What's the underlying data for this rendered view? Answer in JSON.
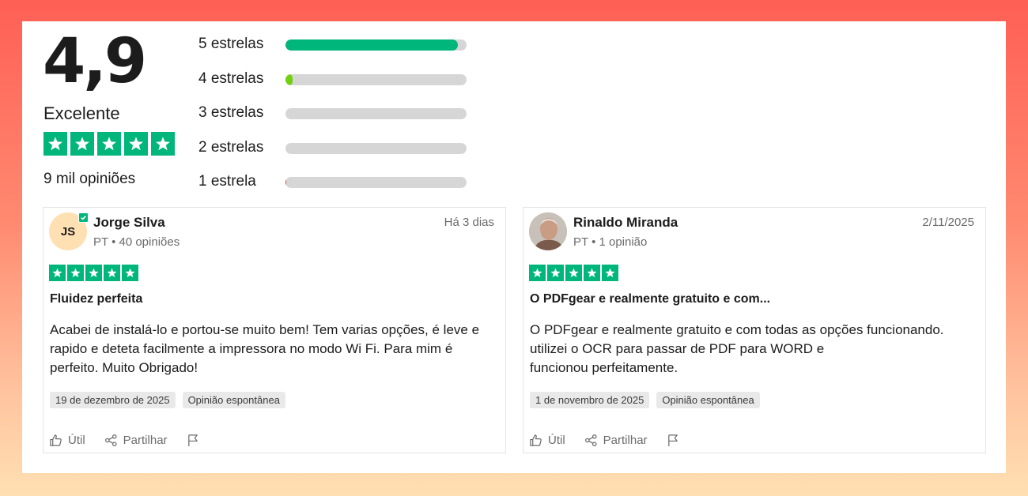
{
  "summary": {
    "score": "4,9",
    "rating_word": "Excelente",
    "stars": 5,
    "review_count": "9 mil opiniões",
    "star_color": "#00b67a"
  },
  "distribution": [
    {
      "label": "5 estrelas",
      "fraction": 0.95,
      "color": "#00b67a"
    },
    {
      "label": "4 estrelas",
      "fraction": 0.04,
      "color": "#73cf11"
    },
    {
      "label": "3 estrelas",
      "fraction": 0.0,
      "color": "#ffce00"
    },
    {
      "label": "2 estrelas",
      "fraction": 0.0,
      "color": "#ff8622"
    },
    {
      "label": "1 estrela",
      "fraction": 0.005,
      "color": "#ff3722"
    }
  ],
  "reviews": [
    {
      "avatar_initials": "JS",
      "name": "Jorge Silva",
      "meta": "PT • 40 opiniões",
      "date": "Há 3 dias",
      "stars": 5,
      "title": "Fluidez perfeita",
      "body": "Acabei de instalá-lo e portou-se muito bem! Tem varias opções, é leve e rapido e deteta facilmente a impressora no modo Wi Fi. Para mim é perfeito. Muito Obrigado!",
      "tags": [
        "19 de dezembro de 2025",
        "Opinião espontânea"
      ],
      "actions": {
        "useful": "Útil",
        "share": "Partilhar"
      }
    },
    {
      "avatar_initials": "",
      "name": "Rinaldo Miranda",
      "meta": "PT • 1 opinião",
      "date": "2/11/2025",
      "stars": 5,
      "title": "O PDFgear e realmente gratuito e com...",
      "body_lines": [
        "O PDFgear e realmente gratuito e com todas as opções funcionando.",
        "utilizei o OCR para passar de PDF para WORD e",
        "funcionou perfeitamente."
      ],
      "tags": [
        "1 de novembro de 2025",
        "Opinião espontânea"
      ],
      "actions": {
        "useful": "Útil",
        "share": "Partilhar"
      }
    }
  ]
}
